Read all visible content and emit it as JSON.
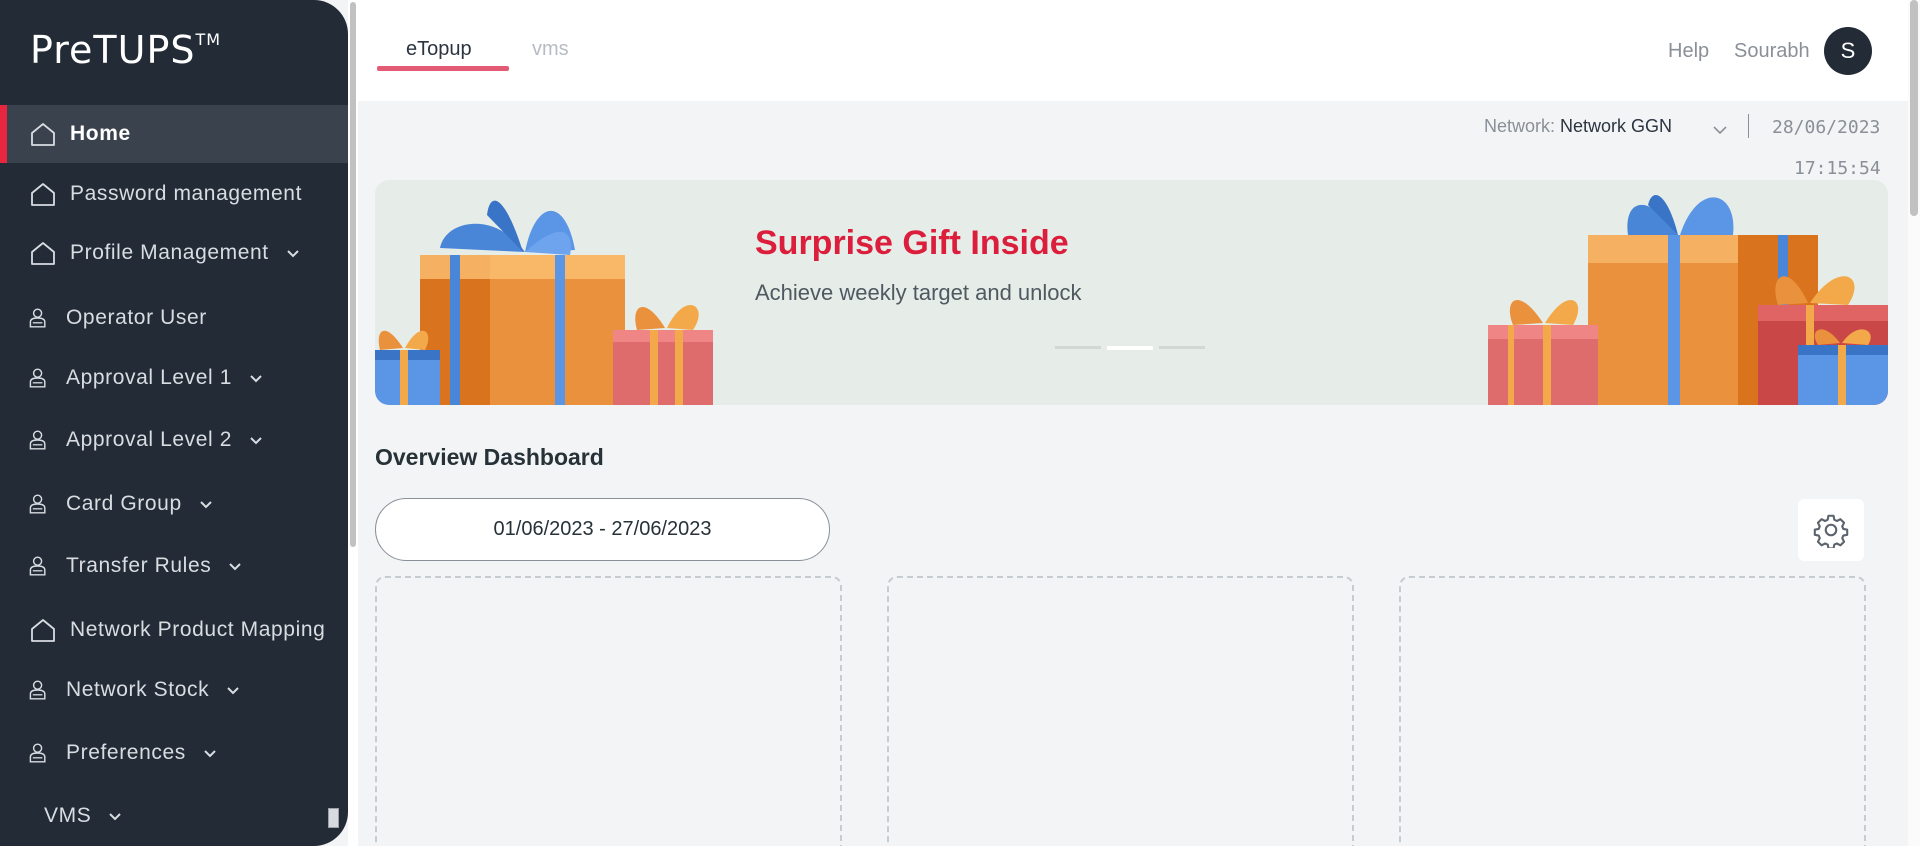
{
  "app": {
    "logo_text": "PreTUPS",
    "logo_mark": "TM"
  },
  "sidebar": {
    "items": [
      {
        "label": "Home",
        "icon": "home-icon",
        "active": true,
        "has_chevron": false
      },
      {
        "label": "Password management",
        "icon": "home-icon",
        "active": false,
        "has_chevron": false
      },
      {
        "label": "Profile Management",
        "icon": "home-icon",
        "active": false,
        "has_chevron": true
      },
      {
        "label": "Operator User",
        "icon": "user-icon",
        "active": false,
        "has_chevron": false
      },
      {
        "label": "Approval Level 1",
        "icon": "user-icon",
        "active": false,
        "has_chevron": true
      },
      {
        "label": "Approval Level 2",
        "icon": "user-icon",
        "active": false,
        "has_chevron": true
      },
      {
        "label": "Card Group",
        "icon": "user-icon",
        "active": false,
        "has_chevron": true
      },
      {
        "label": "Transfer Rules",
        "icon": "user-icon",
        "active": false,
        "has_chevron": true
      },
      {
        "label": "Network Product Mapping",
        "icon": "home-icon",
        "active": false,
        "has_chevron": false
      },
      {
        "label": "Network Stock",
        "icon": "user-icon",
        "active": false,
        "has_chevron": true
      },
      {
        "label": "Preferences",
        "icon": "user-icon",
        "active": false,
        "has_chevron": true
      },
      {
        "label": "VMS",
        "icon": "",
        "active": false,
        "has_chevron": true
      }
    ]
  },
  "header": {
    "tabs": [
      {
        "label": "eTopup",
        "active": true
      },
      {
        "label": "vms",
        "active": false
      }
    ],
    "help_label": "Help",
    "username": "Sourabh",
    "avatar_initial": "S"
  },
  "network": {
    "label": "Network:",
    "value": "Network GGN",
    "date": "28/06/2023",
    "time": "17:15:54"
  },
  "banner": {
    "title": "Surprise Gift Inside",
    "subtitle": "Achieve weekly target and unlock",
    "slide_count": 3,
    "active_slide": 2
  },
  "overview": {
    "title": "Overview Dashboard",
    "date_range": "01/06/2023 - 27/06/2023",
    "settings_icon": "gear-icon"
  },
  "colors": {
    "sidebar_bg": "#222b36",
    "accent": "#e8263f",
    "tab_underline": "#e25a74",
    "banner_title": "#dc1e3d",
    "page_bg": "#f3f4f6"
  }
}
